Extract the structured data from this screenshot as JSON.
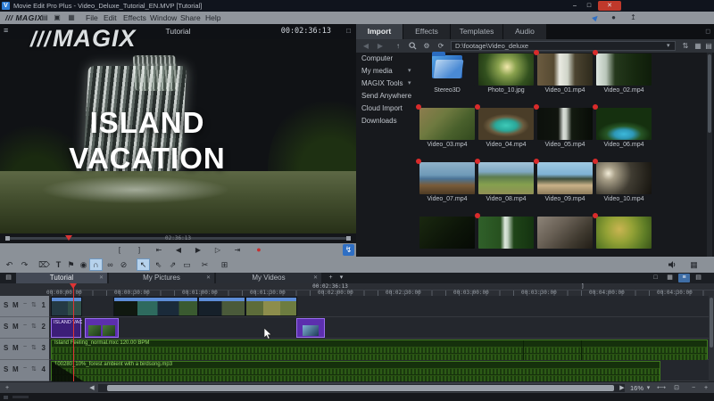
{
  "window": {
    "title": "Movie Edit Pro Plus - Video_Deluxe_Tutorial_EN.MVP [Tutorial]"
  },
  "menubar": {
    "brand": "/// MAGIX",
    "items": [
      "File",
      "Edit",
      "Effects",
      "Window",
      "Share",
      "Help"
    ]
  },
  "preview": {
    "header": {
      "title": "Tutorial",
      "timecode": "00:02:36:13"
    },
    "watermark_slashes": "///",
    "watermark": "MAGIX",
    "overlay": {
      "line1": "ISLAND",
      "line2": "VACATION"
    },
    "scrub_time": "02:36:13",
    "transport": [
      {
        "name": "range-in",
        "glyph": "["
      },
      {
        "name": "range-out",
        "glyph": "]"
      },
      {
        "name": "jump-start",
        "glyph": "⇤"
      },
      {
        "name": "previous-frame",
        "glyph": "◀"
      },
      {
        "name": "play",
        "glyph": "▶"
      },
      {
        "name": "next-frame",
        "glyph": "▷"
      },
      {
        "name": "jump-end",
        "glyph": "⇥"
      },
      {
        "name": "record",
        "glyph": "●"
      }
    ]
  },
  "media": {
    "tabs": [
      "Import",
      "Effects",
      "Templates",
      "Audio"
    ],
    "path": "D:\\footage\\Video_deluxe",
    "tree": [
      "Computer",
      "My media",
      "MAGIX Tools",
      "Send Anywhere",
      "Cloud Import",
      "Downloads"
    ],
    "items": [
      {
        "name": "Stereo3D"
      },
      {
        "name": "Photo_10.jpg"
      },
      {
        "name": "Video_01.mp4"
      },
      {
        "name": "Video_02.mp4"
      },
      {
        "name": "Video_03.mp4"
      },
      {
        "name": "Video_04.mp4"
      },
      {
        "name": "Video_05.mp4"
      },
      {
        "name": "Video_06.mp4"
      },
      {
        "name": "Video_07.mp4"
      },
      {
        "name": "Video_08.mp4"
      },
      {
        "name": "Video_09.mp4"
      },
      {
        "name": "Video_10.mp4"
      }
    ]
  },
  "timeline": {
    "tabs": [
      "Tutorial",
      "My Pictures",
      "My Videos"
    ],
    "range_timecode": "00:02:36:13",
    "range_bracket": "]",
    "ruler_labels": [
      "00:00:00:00",
      "00:00:30:00",
      "00:01:00:00",
      "00:01:30:00",
      "00:02:00:00",
      "00:02:30:00",
      "00:03:00:00",
      "00:03:30:00",
      "00:04:00:00",
      "00:04:30:00"
    ],
    "tracks": [
      "1",
      "2",
      "3",
      "4"
    ],
    "track_buttons": {
      "solo": "S",
      "mute": "M"
    },
    "clips": {
      "title_clip": "ISLAND VAC",
      "music_clip": "Island Feeling_normal.mxc  120.00 BPM",
      "ambience_clip": "100280_10%_forest ambient with a birdsong.mp3"
    },
    "zoom_level": "16%"
  },
  "icons": {
    "app_logo": "V",
    "minimize": "–",
    "maximize": "□",
    "close": "✕",
    "new_doc": "▤",
    "open_folder": "▣",
    "burn": "▦",
    "rocket": "▶",
    "record_circle": "●",
    "upload": "↥",
    "hamburger": "≡",
    "fullscreen": "□",
    "bolt": "↯",
    "back": "◀",
    "forward": "▶",
    "up": "↑",
    "gear": "⚙",
    "refresh": "⟳",
    "caret_down": "▾",
    "sort": "⇅",
    "grid": "▦",
    "list": "▤",
    "pin": "◻",
    "undo": "↶",
    "redo": "↷",
    "trash": "⌦",
    "text_tool": "T",
    "marker": "⚑",
    "binoculars": "◉",
    "magnet": "∩",
    "link": "∞",
    "unlink": "⊘",
    "cursor": "↖",
    "cursor_range": "⇖",
    "cursor_group": "⇗",
    "range_tool": "▭",
    "razor": "✂",
    "object_grid": "⊞",
    "mode_storyboard": "□",
    "mode_overview": "▦",
    "mode_timeline": "≡",
    "mode_multicam": "▤",
    "tab_close": "✕",
    "tab_add": "+",
    "scroll_left": "◀",
    "scroll_right": "▶",
    "add_track": "+",
    "fit_width": "⟷",
    "zoom_box": "⊡",
    "zoom_out": "−",
    "zoom_in": "+",
    "curve": "~",
    "track_arrows": "⇅"
  }
}
